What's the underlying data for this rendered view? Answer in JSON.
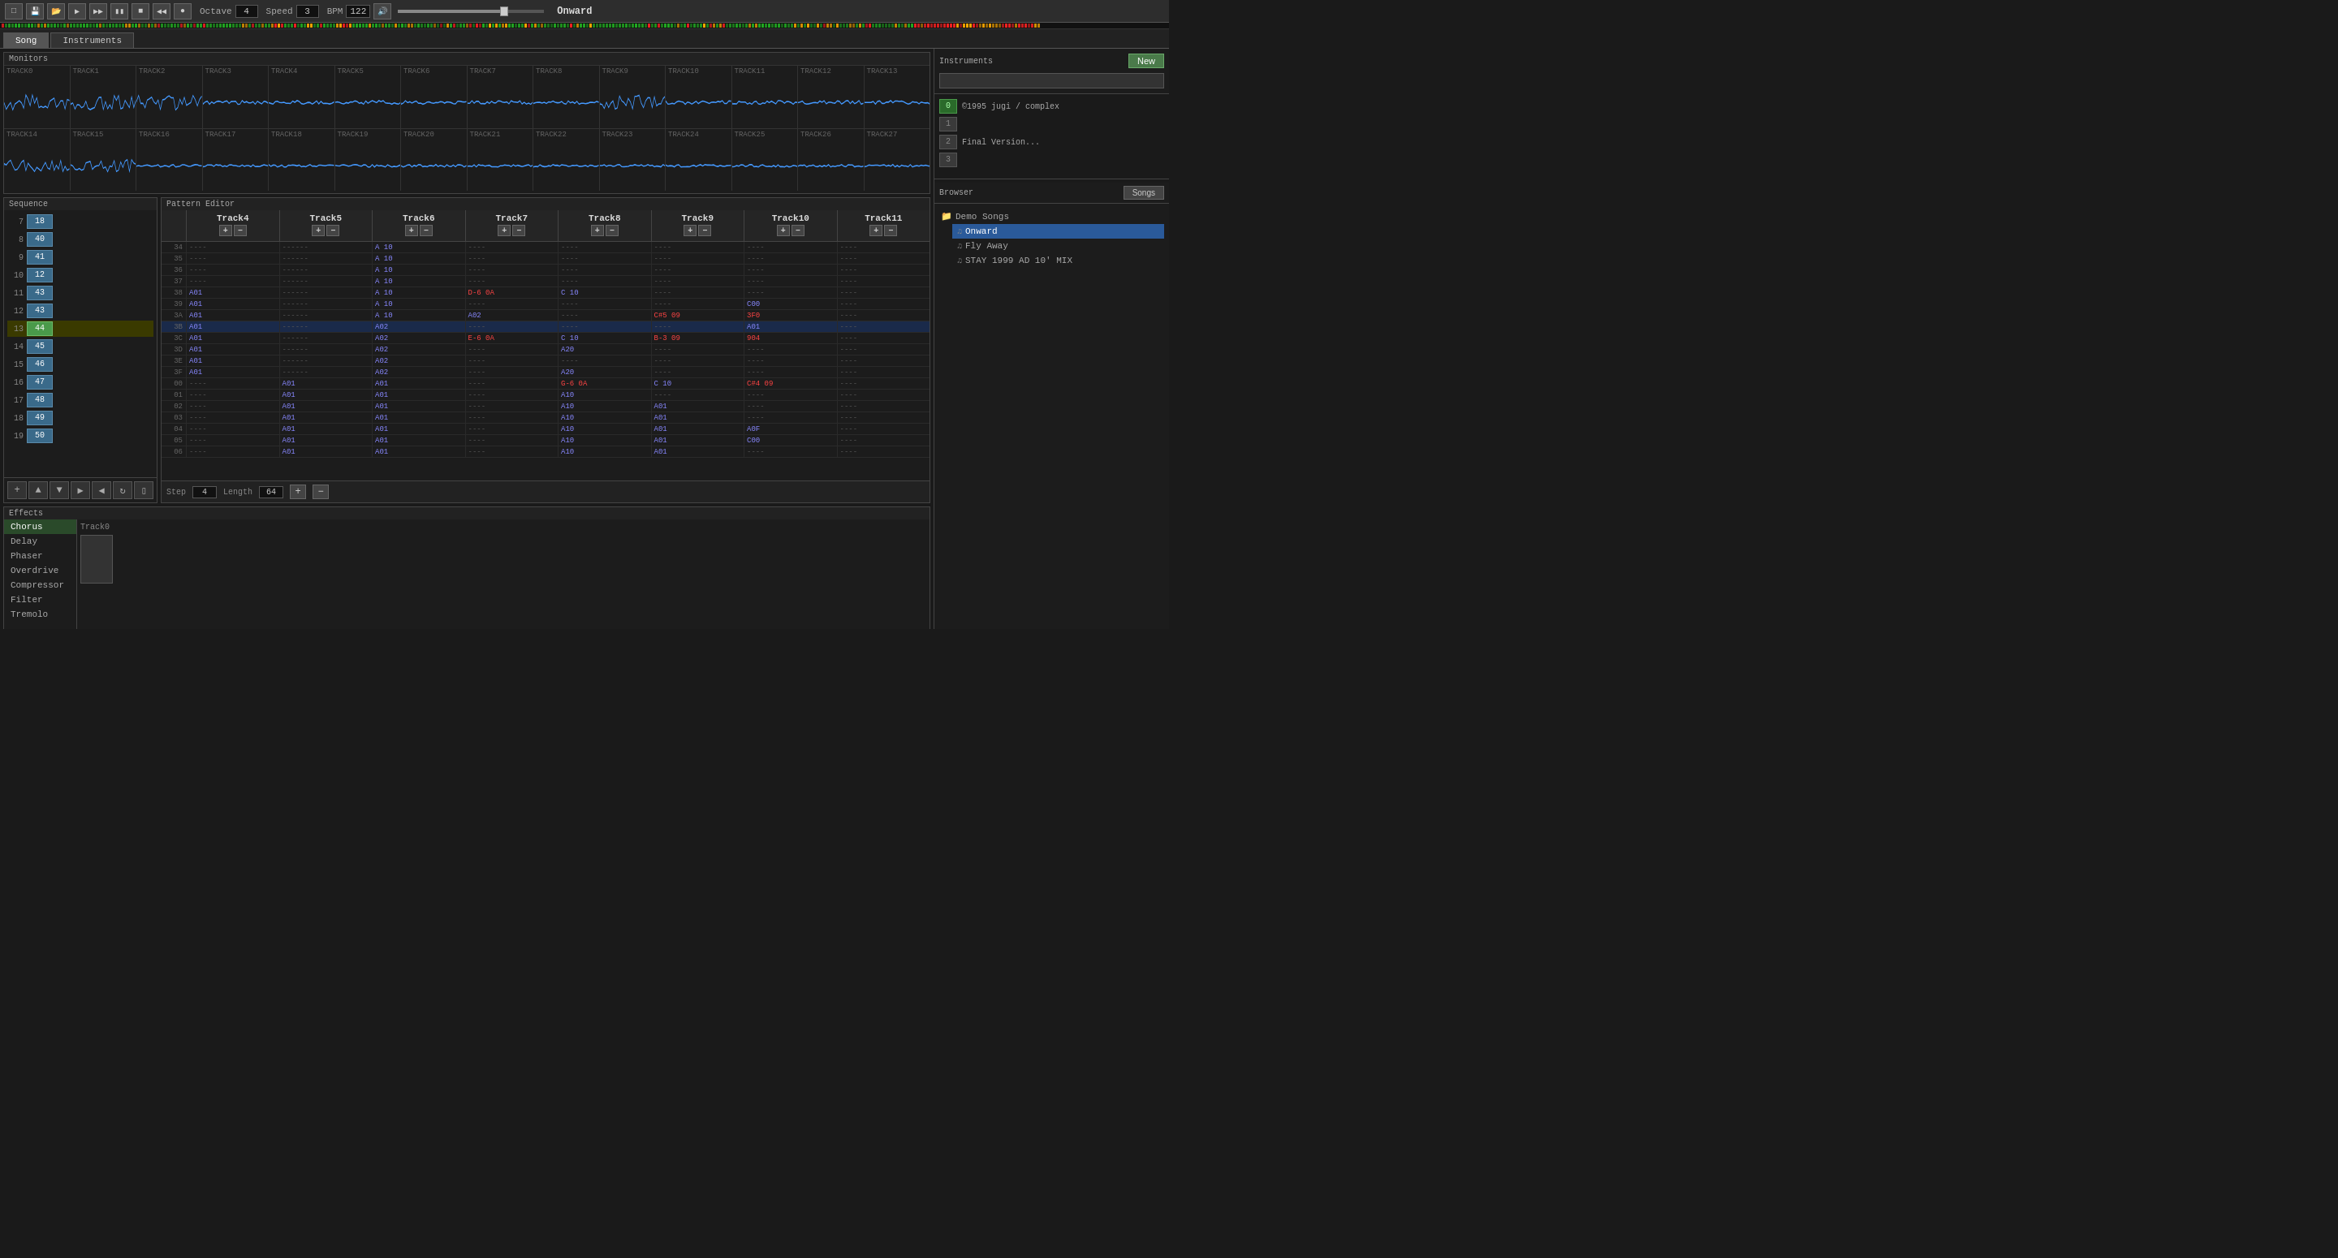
{
  "toolbar": {
    "octave_label": "Octave",
    "octave_val": "4",
    "speed_label": "Speed",
    "speed_val": "3",
    "bpm_label": "BPM",
    "bpm_val": "122",
    "song_title": "Onward",
    "volume_pct": 70
  },
  "tabs": {
    "song_label": "Song",
    "instruments_label": "Instruments",
    "active": "Song"
  },
  "monitors": {
    "title": "Monitors",
    "row1": [
      "TRACK0",
      "TRACK1",
      "TRACK2",
      "TRACK3",
      "TRACK4",
      "TRACK5",
      "TRACK6",
      "TRACK7",
      "TRACK8",
      "TRACK9",
      "TRACK10",
      "TRACK11",
      "TRACK12",
      "TRACK13"
    ],
    "row2": [
      "TRACK14",
      "TRACK15",
      "TRACK16",
      "TRACK17",
      "TRACK18",
      "TRACK19",
      "TRACK20",
      "TRACK21",
      "TRACK22",
      "TRACK23",
      "TRACK24",
      "TRACK25",
      "TRACK26",
      "TRACK27"
    ]
  },
  "sequence": {
    "title": "Sequence",
    "rows": [
      {
        "num": 7,
        "val": 18
      },
      {
        "num": 8,
        "val": 40
      },
      {
        "num": 9,
        "val": 41
      },
      {
        "num": 10,
        "val": 12
      },
      {
        "num": 11,
        "val": 43
      },
      {
        "num": 12,
        "val": 43
      },
      {
        "num": 13,
        "val": 44,
        "active": true
      },
      {
        "num": 14,
        "val": 45
      },
      {
        "num": 15,
        "val": 46
      },
      {
        "num": 16,
        "val": 47
      },
      {
        "num": 17,
        "val": 48
      },
      {
        "num": 18,
        "val": 49
      },
      {
        "num": 19,
        "val": 50
      }
    ]
  },
  "pattern_editor": {
    "title": "Pattern Editor",
    "tracks": [
      "Track4",
      "Track5",
      "Track6",
      "Track7",
      "Track8",
      "Track9",
      "Track10",
      "Track11"
    ],
    "step_label": "Step",
    "step_val": "4",
    "length_label": "Length",
    "length_val": "64",
    "rows": [
      {
        "num": "34",
        "cells": [
          "----",
          "------",
          "A 10",
          "----",
          "----",
          "----",
          "----",
          "----"
        ]
      },
      {
        "num": "35",
        "cells": [
          "----",
          "------",
          "A 10",
          "----",
          "----",
          "----",
          "----",
          "----"
        ]
      },
      {
        "num": "36",
        "cells": [
          "----",
          "------",
          "A 10",
          "----",
          "----",
          "----",
          "----",
          "----"
        ]
      },
      {
        "num": "37",
        "cells": [
          "----",
          "------",
          "A 10",
          "----",
          "----",
          "----",
          "----",
          "----"
        ]
      },
      {
        "num": "38",
        "cells": [
          "A01",
          "------",
          "A 10",
          "D-6 0A",
          "C 10",
          "----",
          "----",
          "----"
        ]
      },
      {
        "num": "39",
        "cells": [
          "A01",
          "------",
          "A 10",
          "----",
          "----",
          "----",
          "C00",
          "----"
        ]
      },
      {
        "num": "3A",
        "cells": [
          "A01",
          "------",
          "A 10",
          "A02",
          "----",
          "C#5 09",
          "3F0",
          "----"
        ]
      },
      {
        "num": "3B",
        "cells": [
          "A01",
          "------",
          "A02",
          "----",
          "----",
          "----",
          "A01",
          "----"
        ],
        "highlight": true
      },
      {
        "num": "3C",
        "cells": [
          "A01",
          "------",
          "A02",
          "E-6 0A",
          "C 10",
          "B-3 09",
          "904",
          "----"
        ]
      },
      {
        "num": "3D",
        "cells": [
          "A01",
          "------",
          "A02",
          "----",
          "A20",
          "----",
          "----",
          "----"
        ]
      },
      {
        "num": "3E",
        "cells": [
          "A01",
          "------",
          "A02",
          "----",
          "----",
          "----",
          "----",
          "----"
        ]
      },
      {
        "num": "3F",
        "cells": [
          "A01",
          "------",
          "A02",
          "----",
          "A20",
          "----",
          "----",
          "----"
        ]
      },
      {
        "num": "00",
        "cells": [
          "----",
          "A01",
          "A01",
          "----",
          "G-6 0A",
          "C 10",
          "C#4 09",
          "----"
        ]
      },
      {
        "num": "01",
        "cells": [
          "----",
          "A01",
          "A01",
          "----",
          "A10",
          "----",
          "----",
          "----"
        ]
      },
      {
        "num": "02",
        "cells": [
          "----",
          "A01",
          "A01",
          "----",
          "A10",
          "A01",
          "----",
          "----"
        ]
      },
      {
        "num": "03",
        "cells": [
          "----",
          "A01",
          "A01",
          "----",
          "A10",
          "A01",
          "----",
          "----"
        ]
      },
      {
        "num": "04",
        "cells": [
          "----",
          "A01",
          "A01",
          "----",
          "A10",
          "A01",
          "A0F",
          "----"
        ]
      },
      {
        "num": "05",
        "cells": [
          "----",
          "A01",
          "A01",
          "----",
          "A10",
          "A01",
          "C00",
          "----"
        ]
      },
      {
        "num": "06",
        "cells": [
          "----",
          "A01",
          "A01",
          "----",
          "A10",
          "A01",
          "----",
          "----"
        ]
      }
    ]
  },
  "effects": {
    "title": "Effects",
    "items": [
      "Chorus",
      "Delay",
      "Phaser",
      "Overdrive",
      "Compressor",
      "Filter",
      "Tremolo"
    ],
    "active_track": "Track0"
  },
  "instruments": {
    "title": "Instruments",
    "new_label": "New",
    "dropdown_placeholder": ""
  },
  "info_rows": [
    {
      "index": "0",
      "text": "©1995 jugi / complex",
      "green": true
    },
    {
      "index": "1",
      "text": ""
    },
    {
      "index": "2",
      "text": "Final Version..."
    },
    {
      "index": "3",
      "text": ""
    }
  ],
  "browser": {
    "title": "Browser",
    "songs_label": "Songs",
    "folders": [
      {
        "name": "Demo Songs",
        "songs": [
          {
            "name": "Onward",
            "active": true
          },
          {
            "name": "Fly Away",
            "active": false
          },
          {
            "name": "STAY 1999 AD 10' MIX",
            "active": false
          }
        ]
      }
    ]
  }
}
